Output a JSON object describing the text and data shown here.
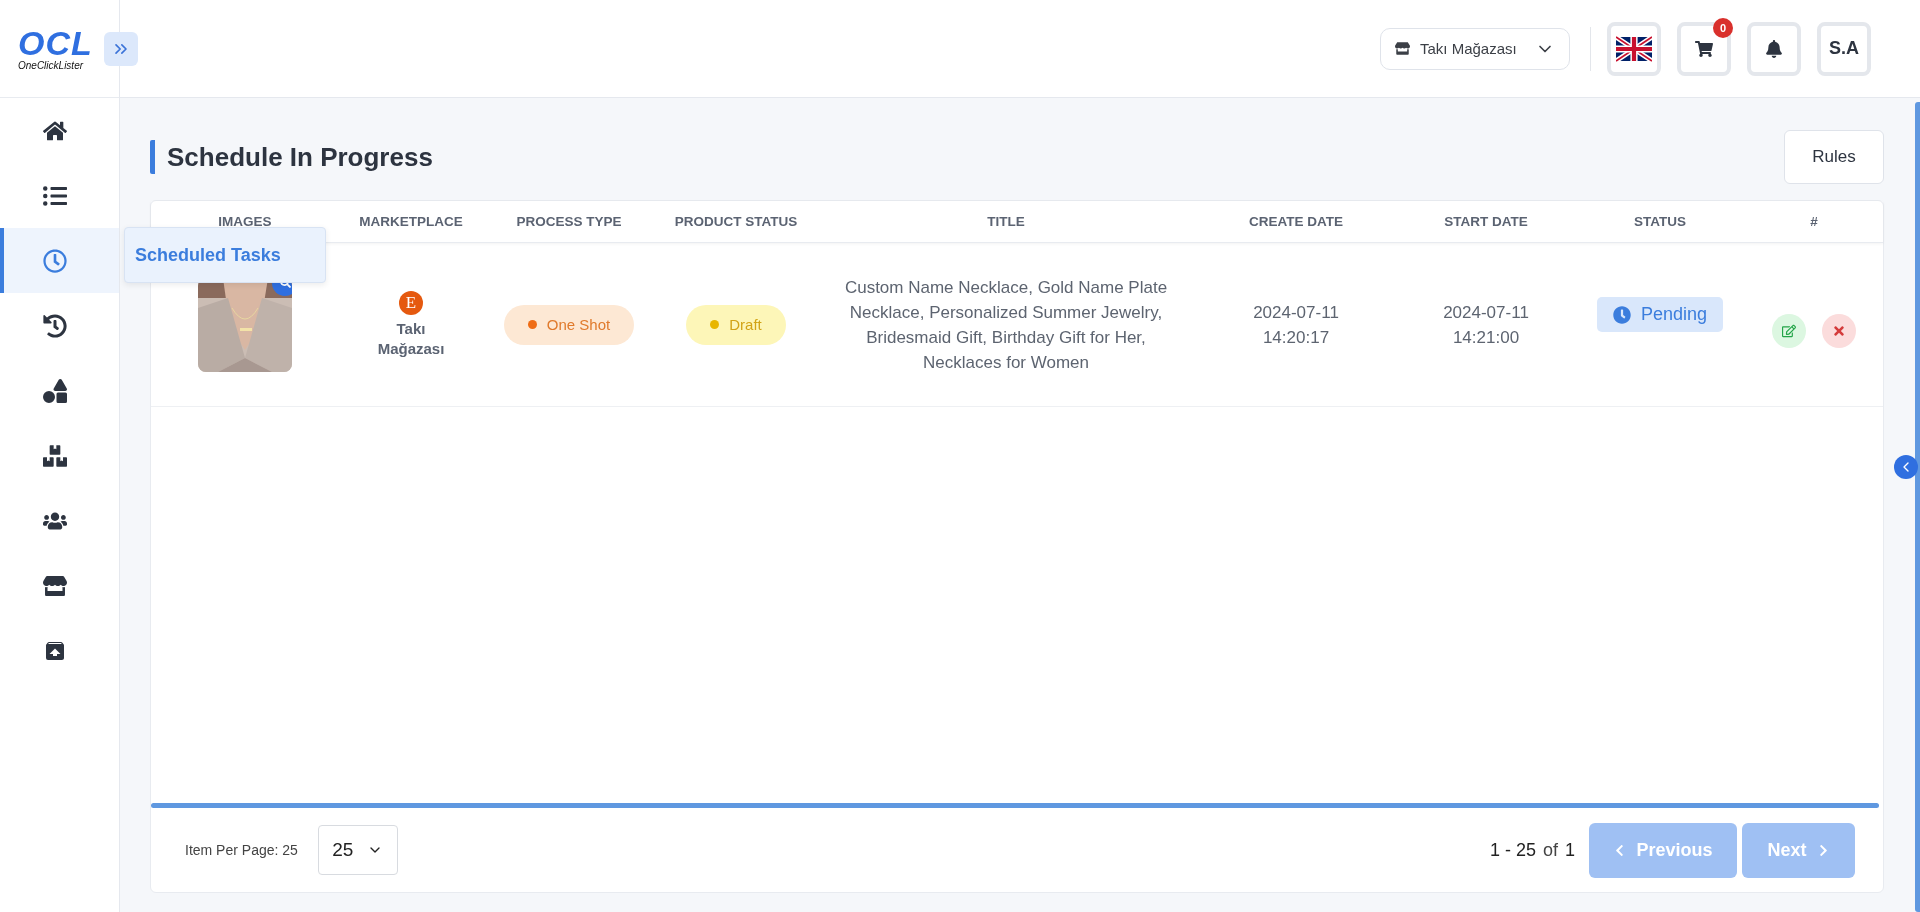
{
  "logo": {
    "mark": "OCL",
    "name": "OneClickLister"
  },
  "sidebar": {
    "items": [
      {
        "selected": false
      },
      {
        "selected": false
      },
      {
        "selected": true,
        "tooltip": "Scheduled Tasks"
      },
      {
        "selected": false
      },
      {
        "selected": false
      },
      {
        "selected": false
      },
      {
        "selected": false
      },
      {
        "selected": false
      },
      {
        "selected": false
      }
    ]
  },
  "header": {
    "store_select": "Takı Mağazası",
    "cart_count": "0",
    "avatar": "S.A"
  },
  "page": {
    "title": "Schedule In Progress",
    "rules_button": "Rules"
  },
  "table": {
    "columns": [
      "IMAGES",
      "MARKETPLACE",
      "PROCESS TYPE",
      "PRODUCT STATUS",
      "TITLE",
      "CREATE DATE",
      "START DATE",
      "STATUS",
      "#"
    ],
    "rows": [
      {
        "marketplace_logo": "E",
        "marketplace": "Takı Mağazası",
        "process_type": "One Shot",
        "product_status": "Draft",
        "title": "Custom Name Necklace, Gold Name Plate Necklace, Personalized Summer Jewelry, Bridesmaid Gift, Birthday Gift for Her, Necklaces for Women",
        "create_date": [
          "2024-07-11",
          "14:20:17"
        ],
        "start_date": [
          "2024-07-11",
          "14:21:00"
        ],
        "status": "Pending"
      }
    ]
  },
  "footer": {
    "items_per_page_label": "Item Per Page: 25",
    "page_size": "25",
    "range": "1 - 25",
    "of_label": "of",
    "total": "1",
    "previous": "Previous",
    "next": "Next",
    "previous_disabled": true,
    "next_disabled": true
  }
}
